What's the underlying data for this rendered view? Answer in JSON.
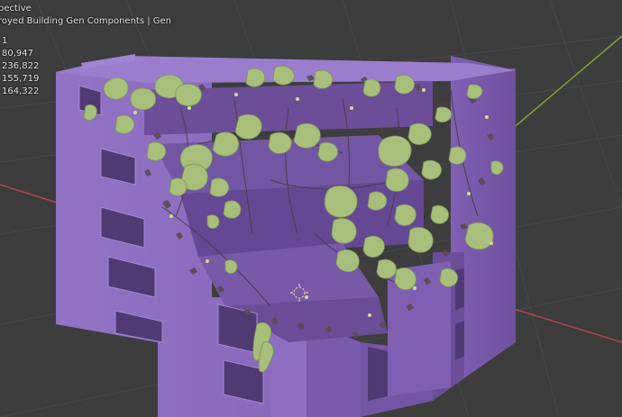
{
  "viewport": {
    "view_mode_text": "pective",
    "object_text": "royed Building Gen Components | Gen",
    "stats": [
      "1",
      "80,947",
      "236,822",
      "155,719",
      "164,322"
    ]
  },
  "colors": {
    "background": "#3d3d3d",
    "building": "#8f6cc2",
    "vegetation": "#a7bf7a",
    "grid_x_axis": "#b0474e",
    "grid_y_axis": "#7f9f3a"
  },
  "icons": {
    "origin": "3d-cursor-icon"
  }
}
